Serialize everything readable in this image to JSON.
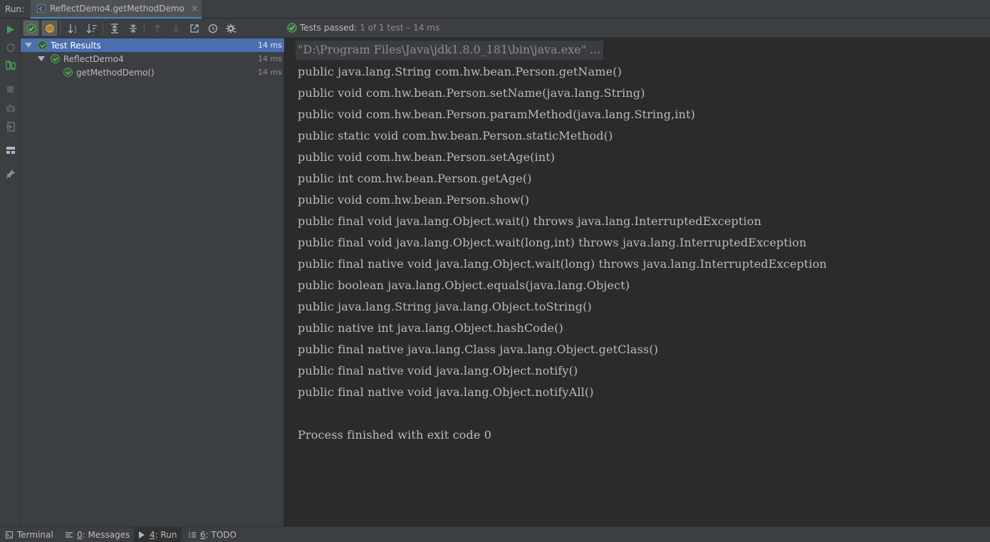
{
  "runbar": {
    "label": "Run:",
    "tab_title": "ReflectDemo4.getMethodDemo",
    "close_glyph": "×"
  },
  "statusbar": {
    "status_label": "Tests passed:",
    "status_rest": "1 of 1 test – 14 ms"
  },
  "tree": {
    "nodes": [
      {
        "label": "Test Results",
        "time": "14 ms"
      },
      {
        "label": "ReflectDemo4",
        "time": "14 ms"
      },
      {
        "label": "getMethodDemo()",
        "time": "14 ms"
      }
    ]
  },
  "console": {
    "command": "\"D:\\Program Files\\Java\\jdk1.8.0_181\\bin\\java.exe\" ...",
    "lines": [
      "public java.lang.String com.hw.bean.Person.getName()",
      "public void com.hw.bean.Person.setName(java.lang.String)",
      "public void com.hw.bean.Person.paramMethod(java.lang.String,int)",
      "public static void com.hw.bean.Person.staticMethod()",
      "public void com.hw.bean.Person.setAge(int)",
      "public int com.hw.bean.Person.getAge()",
      "public void com.hw.bean.Person.show()",
      "public final void java.lang.Object.wait() throws java.lang.InterruptedException",
      "public final void java.lang.Object.wait(long,int) throws java.lang.InterruptedException",
      "public final native void java.lang.Object.wait(long) throws java.lang.InterruptedException",
      "public boolean java.lang.Object.equals(java.lang.Object)",
      "public java.lang.String java.lang.Object.toString()",
      "public native int java.lang.Object.hashCode()",
      "public final native java.lang.Class java.lang.Object.getClass()",
      "public final native void java.lang.Object.notify()",
      "public final native void java.lang.Object.notifyAll()"
    ],
    "exit": "Process finished with exit code 0"
  },
  "bottombar": {
    "terminal": "Terminal",
    "messages_num": "0",
    "messages_label": ": Messages",
    "run_num": "4",
    "run_label": ": Run",
    "todo_num": "6",
    "todo_label": ": TODO"
  },
  "icons": {
    "rerun": "play-icon",
    "stop": "stop-icon",
    "camera": "camera-icon",
    "pin": "pin-icon"
  },
  "colors": {
    "success": "#499c54",
    "selection": "#4b6eaf",
    "panel": "#3c3f41",
    "console_bg": "#2b2b2b"
  }
}
